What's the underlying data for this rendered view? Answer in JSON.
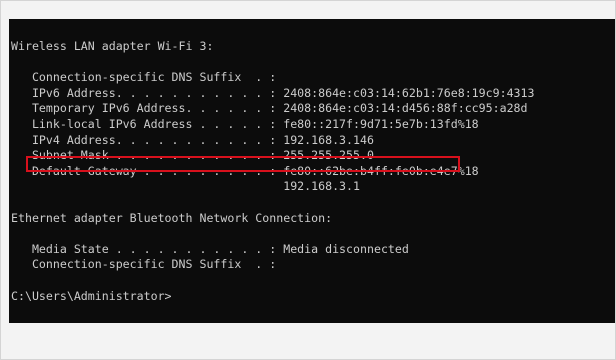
{
  "console": {
    "lines": [
      "Wireless LAN adapter Wi-Fi 3:",
      "",
      "   Connection-specific DNS Suffix  . :",
      "   IPv6 Address. . . . . . . . . . . : 2408:864e:c03:14:62b1:76e8:19c9:4313",
      "   Temporary IPv6 Address. . . . . . : 2408:864e:c03:14:d456:88f:cc95:a28d",
      "   Link-local IPv6 Address . . . . . : fe80::217f:9d71:5e7b:13fd%18",
      "   IPv4 Address. . . . . . . . . . . : 192.168.3.146",
      "   Subnet Mask . . . . . . . . . . . : 255.255.255.0",
      "   Default Gateway . . . . . . . . . : fe80::62be:b4ff:fe0b:e4e7%18",
      "                                       192.168.3.1",
      "",
      "Ethernet adapter Bluetooth Network Connection:",
      "",
      "   Media State . . . . . . . . . . . : Media disconnected",
      "   Connection-specific DNS Suffix  . :",
      "",
      "C:\\Users\\Administrator>"
    ]
  },
  "colors": {
    "background": "#0c0c0c",
    "text": "#cccccc",
    "highlight": "#d8101c"
  }
}
